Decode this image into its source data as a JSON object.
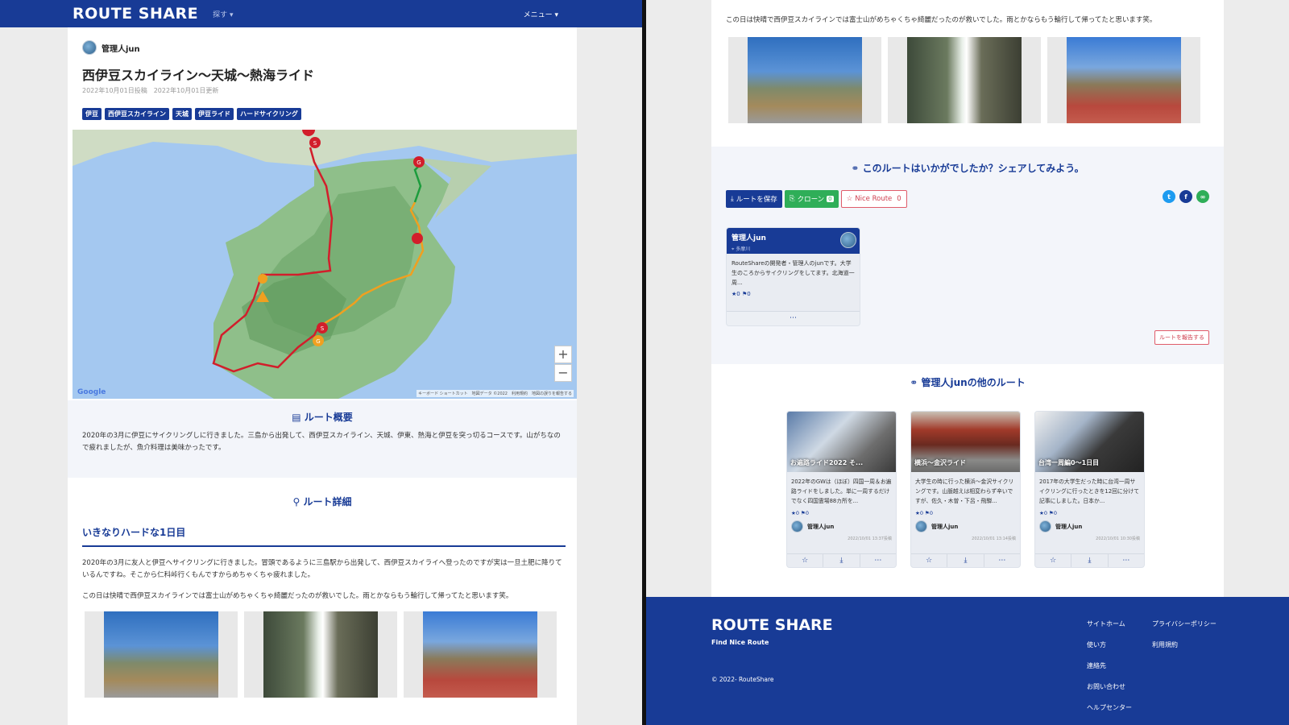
{
  "nav": {
    "logo": "ROUTE SHARE",
    "search": "探す ▾",
    "menu": "メニュー ▾"
  },
  "post": {
    "author": "管理人jun",
    "title": "西伊豆スカイライン〜天城〜熱海ライド",
    "dates": "2022年10月01日投稿　2022年10月01日更新",
    "tags": [
      "伊豆",
      "西伊豆スカイライン",
      "天城",
      "伊豆ライド",
      "ハードサイクリング"
    ]
  },
  "map": {
    "zoom_in": "+",
    "zoom_out": "−",
    "google": "Google",
    "footer": "キーボード ショートカット　地図データ ©2022　利用規約　地図の誤りを報告する",
    "marker_s": "S",
    "marker_g": "G",
    "colors": {
      "route_red": "#d21e2b",
      "route_orange": "#f0a020",
      "route_green": "#1c9c3c",
      "sea": "#9fc4ef",
      "land": "#c9dcc0"
    }
  },
  "summary": {
    "heading": "ルート概要",
    "text": "2020年の3月に伊豆にサイクリングしに行きました。三島から出発して、西伊豆スカイライン、天城、伊東、熱海と伊豆を突っ切るコースです。山がちなので疲れましたが、魚介料理は美味かったです。"
  },
  "detail": {
    "heading": "ルート詳細",
    "day_heading": "いきなりハードな1日目",
    "para1": "2020年の3月に友人と伊豆へサイクリングに行きました。冒頭であるように三島駅から出発して、西伊豆スカイライへ登ったのですが実は一旦土肥に降りているんですね。そこから仁科峠行くもんですからめちゃくちゃ疲れました。",
    "para2": "この日は快晴で西伊豆スカイラインでは富士山がめちゃくちゃ綺麗だったのが救いでした。雨とかならもう輪行して帰ってたと思います笑。"
  },
  "share": {
    "heading": "このルートはいかがでしたか？シェアしてみよう。",
    "save": "ルートを保存",
    "clone": "クローン",
    "clone_count": "0",
    "nice": "Nice Route",
    "nice_count": "0",
    "report": "ルートを報告する"
  },
  "user_card": {
    "name": "管理人jun",
    "location": "多摩川",
    "bio": "RouteShareの開発者・管理人のjunです。大学生のころからサイクリングをしてます。北海道一周...",
    "stats": "★0  ⚑0",
    "more": "⋯"
  },
  "other": {
    "heading": "管理人junの他のルート",
    "routes": [
      {
        "title": "お遍路ライド2022 そ...",
        "desc": "2022年のGWは（ほぼ）四国一周＆お遍路ライドをしました。単に一周するだけでなく四国霊場88カ所を...",
        "stats": "★0  ⚑0",
        "author": "管理人jun",
        "date": "2022/10/01 13:37投稿"
      },
      {
        "title": "横浜〜金沢ライド",
        "desc": "大学生の時に行った横浜〜金沢サイクリングです。山脈越えは相変わらず辛いですが、佐久・木曽・下呂・飛騨...",
        "stats": "★0  ⚑0",
        "author": "管理人jun",
        "date": "2022/10/01 13:14投稿"
      },
      {
        "title": "台湾一周編0〜1日目",
        "desc": "2017年の大学生だった時に台湾一周サイクリングに行ったときを12回に分けて記事にしました。日本か...",
        "stats": "★0  ⚑0",
        "author": "管理人jun",
        "date": "2022/10/01 10:30投稿"
      }
    ],
    "actions": [
      "☆",
      "⤓",
      "⋯"
    ]
  },
  "footer": {
    "logo": "ROUTE SHARE",
    "tagline": "Find Nice Route",
    "copyright": "© 2022- RouteShare",
    "col1": [
      "サイトホーム",
      "使い方",
      "連絡先",
      "お問い合わせ",
      "ヘルプセンター"
    ],
    "col2": [
      "プライバシーポリシー",
      "利用規約"
    ]
  }
}
